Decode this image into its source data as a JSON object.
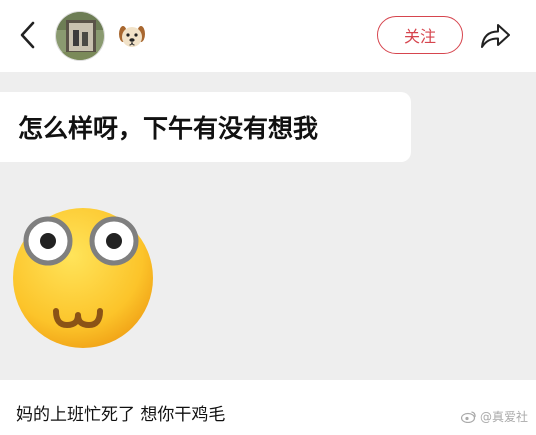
{
  "header": {
    "follow_label": "关注",
    "icons": {
      "back": "chevron-left-icon",
      "share": "share-arrow-icon",
      "badge": "dog-emoji-icon"
    }
  },
  "post": {
    "bubble_text": "怎么样呀，下午有没有想我",
    "emoji": "bug-eyed-smiley-emoji",
    "caption": "妈的上班忙死了 想你干鸡毛"
  },
  "watermark": {
    "text": "@真爱社"
  },
  "colors": {
    "accent": "#d6454e",
    "content_bg": "#eeeeee",
    "bubble_bg": "#ffffff"
  }
}
